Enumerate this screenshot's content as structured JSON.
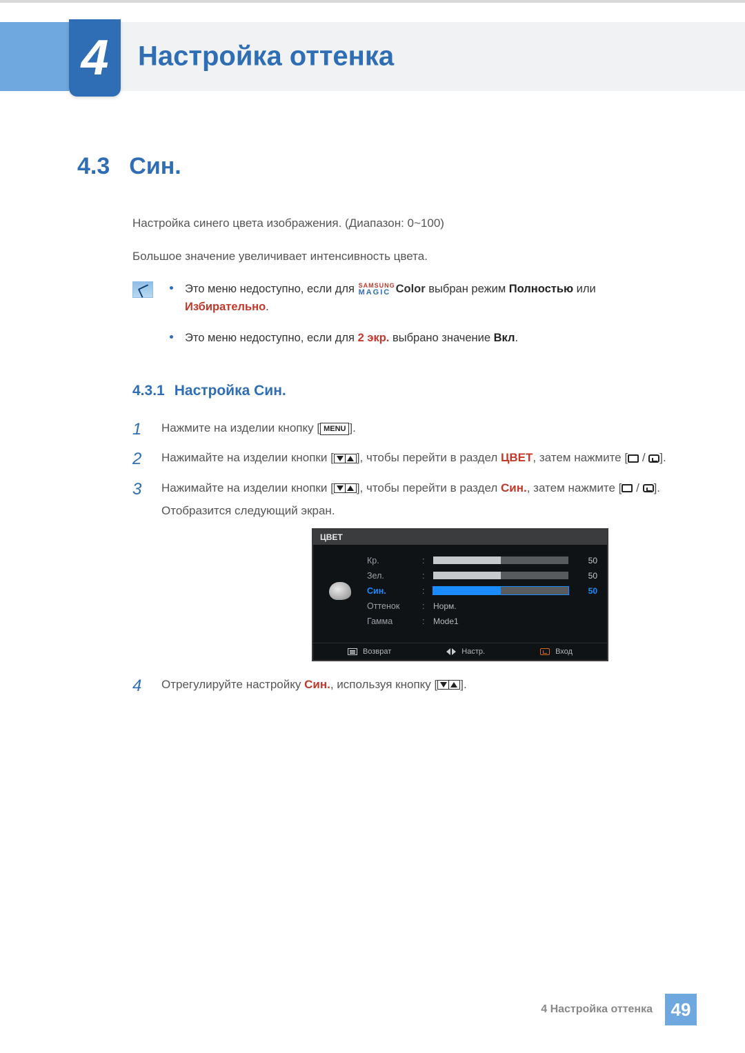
{
  "chapter": {
    "number": "4",
    "title": "Настройка оттенка"
  },
  "section": {
    "number": "4.3",
    "title": "Син."
  },
  "paragraphs": {
    "p1": "Настройка синего цвета изображения. (Диапазон: 0~100)",
    "p2": "Большое значение увеличивает интенсивность цвета."
  },
  "notes": {
    "n1_pre": "Это меню недоступно, если для ",
    "n1_magic_samsung": "SAMSUNG",
    "n1_magic_magic": "MAGIC",
    "n1_magic_color": "Color",
    "n1_mid": " выбран режим ",
    "n1_mode1": "Полностью",
    "n1_or": " или ",
    "n1_mode2": "Избирательно",
    "n1_end": ".",
    "n2_pre": "Это меню недоступно, если для ",
    "n2_key": "2 экр.",
    "n2_mid": " выбрано значение ",
    "n2_val": "Вкл",
    "n2_end": "."
  },
  "subsection": {
    "number": "4.3.1",
    "title": "Настройка Син."
  },
  "steps": {
    "s1_num": "1",
    "s1_pre": "Нажмите на изделии кнопку [",
    "s1_key": "MENU",
    "s1_post": "].",
    "s2_num": "2",
    "s2_pre": "Нажимайте на изделии кнопки [",
    "s2_mid": "], чтобы перейти в раздел ",
    "s2_target": "ЦВЕТ",
    "s2_then": ", затем нажмите [",
    "s2_post": "].",
    "s3_num": "3",
    "s3_pre": "Нажимайте на изделии кнопки [",
    "s3_mid": "], чтобы перейти в раздел ",
    "s3_target": "Син.",
    "s3_then": ", затем нажмите [",
    "s3_post": "].",
    "s3_after": "Отобразится следующий экран.",
    "s4_num": "4",
    "s4_pre": "Отрегулируйте настройку ",
    "s4_target": "Син.",
    "s4_mid": ", используя кнопку [",
    "s4_post": "]."
  },
  "osd": {
    "header": "ЦВЕТ",
    "rows": [
      {
        "label": "Кр.",
        "value": "50",
        "fill": 50,
        "highlight": false,
        "type": "bar"
      },
      {
        "label": "Зел.",
        "value": "50",
        "fill": 50,
        "highlight": false,
        "type": "bar"
      },
      {
        "label": "Син.",
        "value": "50",
        "fill": 50,
        "highlight": true,
        "type": "bar"
      },
      {
        "label": "Оттенок",
        "text": "Норм.",
        "type": "text"
      },
      {
        "label": "Гамма",
        "text": "Mode1",
        "type": "text"
      }
    ],
    "footer": {
      "back": "Возврат",
      "adjust": "Настр.",
      "enter": "Вход"
    }
  },
  "footer": {
    "text": "4 Настройка оттенка",
    "page": "49"
  }
}
